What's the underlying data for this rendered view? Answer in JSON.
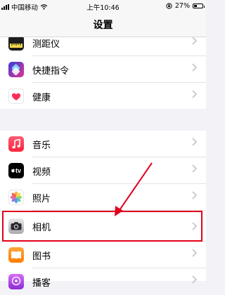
{
  "status_bar": {
    "carrier": "中国移动",
    "time": "上午10:46",
    "battery": "27%"
  },
  "nav": {
    "title": "设置"
  },
  "groups": [
    {
      "items": [
        {
          "label": "测距仪",
          "icon": "measure-icon"
        },
        {
          "label": "快捷指令",
          "icon": "shortcuts-icon"
        },
        {
          "label": "健康",
          "icon": "health-heart-icon"
        }
      ]
    },
    {
      "items": [
        {
          "label": "音乐",
          "icon": "music-note-icon"
        },
        {
          "label": "视频",
          "icon": "apple-tv-icon",
          "icon_text": "tv"
        },
        {
          "label": "照片",
          "icon": "photos-flower-icon"
        },
        {
          "label": "相机",
          "icon": "camera-icon"
        },
        {
          "label": "图书",
          "icon": "books-icon"
        },
        {
          "label": "播客",
          "icon": "podcasts-icon"
        }
      ]
    }
  ],
  "highlighted_item": "相机",
  "colors": {
    "highlight": "#e0001b",
    "background": "#f2f2f7",
    "chevron": "#c4c4c7"
  }
}
